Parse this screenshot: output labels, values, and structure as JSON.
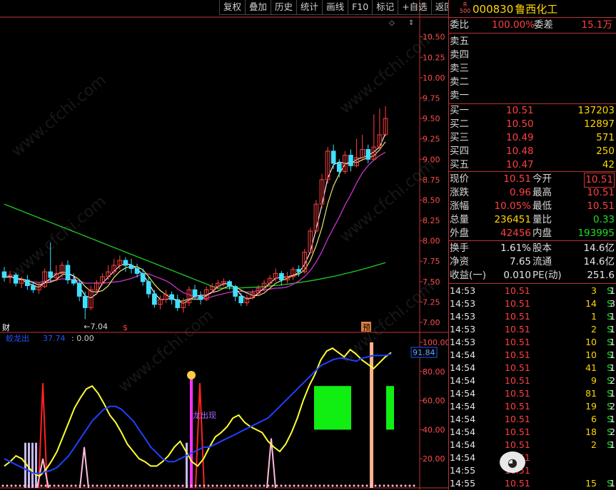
{
  "toolbar": {
    "items": [
      "复权",
      "叠加",
      "历史",
      "统计",
      "画线",
      "F10",
      "标记",
      "+自选",
      "返回"
    ]
  },
  "header": {
    "badge_top": "R",
    "badge_bottom": "500",
    "code": "000830",
    "name": "鲁西化工"
  },
  "quote": {
    "weibi_label": "委比",
    "weibi_value": "100.00%",
    "weicha_label": "委差",
    "weicha_value": "15.1万",
    "sell": [
      {
        "label": "卖五",
        "price": "",
        "volume": ""
      },
      {
        "label": "卖四",
        "price": "",
        "volume": ""
      },
      {
        "label": "卖三",
        "price": "",
        "volume": ""
      },
      {
        "label": "卖二",
        "price": "",
        "volume": ""
      },
      {
        "label": "卖一",
        "price": "",
        "volume": ""
      }
    ],
    "buy": [
      {
        "label": "买一",
        "price": "10.51",
        "volume": "137203"
      },
      {
        "label": "买二",
        "price": "10.50",
        "volume": "12897"
      },
      {
        "label": "买三",
        "price": "10.49",
        "volume": "571"
      },
      {
        "label": "买四",
        "price": "10.48",
        "volume": "250"
      },
      {
        "label": "买五",
        "price": "10.47",
        "volume": "42"
      }
    ],
    "stats": [
      {
        "l1": "现价",
        "v1": "10.51",
        "l2": "今开",
        "v2": "10.51"
      },
      {
        "l1": "涨跌",
        "v1": "0.96",
        "l2": "最高",
        "v2": "10.51"
      },
      {
        "l1": "涨幅",
        "v1": "10.05%",
        "l2": "最低",
        "v2": "10.51"
      },
      {
        "l1": "总量",
        "v1": "236451",
        "l2": "量比",
        "v2": "0.33"
      },
      {
        "l1": "外盘",
        "v1": "42456",
        "l2": "内盘",
        "v2": "193995"
      }
    ],
    "fund": [
      {
        "l1": "换手",
        "v1": "1.61%",
        "l2": "股本",
        "v2": "14.6亿"
      },
      {
        "l1": "净资",
        "v1": "7.65",
        "l2": "流通",
        "v2": "14.6亿"
      },
      {
        "l1": "收益(一)",
        "v1": "0.010",
        "l2": "PE(动)",
        "v2": "251.6"
      }
    ]
  },
  "ticks": [
    {
      "time": "14:53",
      "price": "10.51",
      "vol": "3",
      "side": "S",
      "n": "1"
    },
    {
      "time": "14:53",
      "price": "10.51",
      "vol": "14",
      "side": "S",
      "n": "3"
    },
    {
      "time": "14:53",
      "price": "10.51",
      "vol": "1",
      "side": "S",
      "n": "1"
    },
    {
      "time": "14:53",
      "price": "10.51",
      "vol": "2",
      "side": "S",
      "n": "1"
    },
    {
      "time": "14:53",
      "price": "10.51",
      "vol": "10",
      "side": "S",
      "n": "1"
    },
    {
      "time": "14:54",
      "price": "10.51",
      "vol": "10",
      "side": "S",
      "n": "1"
    },
    {
      "time": "14:54",
      "price": "10.51",
      "vol": "41",
      "side": "S",
      "n": "1"
    },
    {
      "time": "14:54",
      "price": "10.51",
      "vol": "9",
      "side": "S",
      "n": "2"
    },
    {
      "time": "14:54",
      "price": "10.51",
      "vol": "81",
      "side": "S",
      "n": "1"
    },
    {
      "time": "14:54",
      "price": "10.51",
      "vol": "19",
      "side": "S",
      "n": "2"
    },
    {
      "time": "14:54",
      "price": "10.51",
      "vol": "6",
      "side": "S",
      "n": "1"
    },
    {
      "time": "14:54",
      "price": "10.51",
      "vol": "18",
      "side": "S",
      "n": "2"
    },
    {
      "time": "14:54",
      "price": "10.51",
      "vol": "2",
      "side": "S",
      "n": "1"
    },
    {
      "time": "14:54",
      "price": "10.51",
      "vol": "",
      "side": "",
      "n": ""
    },
    {
      "time": "14:55",
      "price": "10.51",
      "vol": "",
      "side": "",
      "n": ""
    },
    {
      "time": "14:55",
      "price": "10.51",
      "vol": "15",
      "side": "S",
      "n": "1"
    }
  ],
  "chart_data": [
    {
      "type": "candlestick",
      "ylim": [
        7.0,
        10.55
      ],
      "yticks": [
        "10.50",
        "10.25",
        "10.00",
        "9.75",
        "9.50",
        "9.25",
        "9.00",
        "8.75",
        "8.50",
        "8.25",
        "8.00",
        "7.75",
        "7.50",
        "7.25",
        "7.00"
      ],
      "low_annotation": "←7.04",
      "markers": [
        "财",
        "$",
        "预"
      ],
      "candles": [
        [
          7.62,
          7.55,
          7.68,
          7.5
        ],
        [
          7.55,
          7.58,
          7.63,
          7.48
        ],
        [
          7.58,
          7.48,
          7.61,
          7.44
        ],
        [
          7.48,
          7.52,
          7.56,
          7.42
        ],
        [
          7.52,
          7.45,
          7.58,
          7.4
        ],
        [
          7.45,
          7.4,
          7.5,
          7.36
        ],
        [
          7.4,
          7.44,
          7.49,
          7.35
        ],
        [
          7.44,
          7.62,
          7.66,
          7.42
        ],
        [
          7.62,
          7.55,
          7.98,
          7.5
        ],
        [
          7.55,
          7.6,
          7.7,
          7.5
        ],
        [
          7.6,
          7.7,
          7.74,
          7.55
        ],
        [
          7.7,
          7.52,
          7.76,
          7.47
        ],
        [
          7.52,
          7.48,
          7.6,
          7.45
        ],
        [
          7.48,
          7.32,
          7.52,
          7.26
        ],
        [
          7.32,
          7.18,
          7.38,
          7.04
        ],
        [
          7.18,
          7.4,
          7.45,
          7.15
        ],
        [
          7.4,
          7.48,
          7.52,
          7.34
        ],
        [
          7.48,
          7.56,
          7.6,
          7.46
        ],
        [
          7.56,
          7.62,
          7.7,
          7.52
        ],
        [
          7.62,
          7.7,
          7.78,
          7.58
        ],
        [
          7.7,
          7.76,
          7.82,
          7.65
        ],
        [
          7.76,
          7.7,
          7.8,
          7.62
        ],
        [
          7.7,
          7.66,
          7.78,
          7.6
        ],
        [
          7.66,
          7.6,
          7.72,
          7.55
        ],
        [
          7.6,
          7.5,
          7.66,
          7.45
        ],
        [
          7.5,
          7.35,
          7.56,
          7.3
        ],
        [
          7.35,
          7.22,
          7.4,
          7.18
        ],
        [
          7.22,
          7.28,
          7.33,
          7.16
        ],
        [
          7.28,
          7.34,
          7.4,
          7.24
        ],
        [
          7.34,
          7.28,
          7.38,
          7.22
        ],
        [
          7.28,
          7.18,
          7.34,
          7.14
        ],
        [
          7.18,
          7.24,
          7.3,
          7.12
        ],
        [
          7.24,
          7.4,
          7.44,
          7.2
        ],
        [
          7.4,
          7.32,
          7.46,
          7.28
        ],
        [
          7.32,
          7.28,
          7.38,
          7.22
        ],
        [
          7.28,
          7.4,
          7.44,
          7.26
        ],
        [
          7.4,
          7.44,
          7.48,
          7.36
        ],
        [
          7.44,
          7.48,
          7.52,
          7.4
        ],
        [
          7.48,
          7.5,
          7.54,
          7.44
        ],
        [
          7.5,
          7.44,
          7.52,
          7.4
        ],
        [
          7.44,
          7.32,
          7.46,
          7.26
        ],
        [
          7.32,
          7.24,
          7.36,
          7.2
        ],
        [
          7.24,
          7.3,
          7.34,
          7.2
        ],
        [
          7.3,
          7.36,
          7.4,
          7.28
        ],
        [
          7.36,
          7.42,
          7.46,
          7.32
        ],
        [
          7.42,
          7.48,
          7.52,
          7.38
        ],
        [
          7.48,
          7.54,
          7.58,
          7.44
        ],
        [
          7.54,
          7.6,
          7.66,
          7.5
        ],
        [
          7.6,
          7.52,
          7.63,
          7.45
        ],
        [
          7.52,
          7.56,
          7.62,
          7.48
        ],
        [
          7.56,
          7.65,
          7.68,
          7.52
        ],
        [
          7.65,
          7.62,
          7.7,
          7.56
        ],
        [
          7.62,
          7.86,
          7.9,
          7.6
        ],
        [
          7.86,
          8.12,
          8.16,
          7.84
        ],
        [
          8.12,
          8.45,
          8.5,
          8.1
        ],
        [
          8.45,
          8.75,
          8.82,
          8.4
        ],
        [
          8.75,
          9.1,
          9.15,
          8.7
        ],
        [
          9.1,
          8.95,
          9.18,
          8.88
        ],
        [
          8.95,
          8.85,
          9.0,
          8.78
        ],
        [
          8.85,
          9.05,
          9.1,
          8.82
        ],
        [
          9.05,
          8.92,
          9.12,
          8.85
        ],
        [
          8.92,
          9.02,
          9.25,
          8.9
        ],
        [
          9.02,
          9.12,
          9.3,
          9.0
        ],
        [
          9.12,
          9.0,
          9.18,
          8.95
        ],
        [
          9.0,
          9.15,
          9.55,
          8.98
        ],
        [
          9.15,
          9.3,
          9.62,
          9.1
        ],
        [
          9.3,
          9.5,
          9.65,
          9.28
        ]
      ]
    },
    {
      "type": "line",
      "title": "蛟龙出",
      "value": "37.74",
      "extra": ": 0.00",
      "ylim": [
        0,
        100
      ],
      "yticks": [
        "100.00",
        "80.00",
        "60.00",
        "40.00",
        "20.00"
      ],
      "current_label": "91.84",
      "annotation": "龙出现",
      "series": [
        {
          "name": "yellow",
          "color": "#ffff33",
          "values": [
            15,
            18,
            22,
            20,
            15,
            10,
            8,
            12,
            18,
            25,
            35,
            45,
            55,
            62,
            68,
            70,
            65,
            58,
            50,
            45,
            38,
            30,
            25,
            20,
            18,
            15,
            15,
            18,
            22,
            28,
            32,
            25,
            18,
            15,
            20,
            28,
            35,
            38,
            42,
            48,
            50,
            45,
            42,
            40,
            38,
            32,
            28,
            25,
            30,
            38,
            48,
            60,
            70,
            78,
            88,
            94,
            96,
            93,
            90,
            95,
            92,
            88,
            85,
            82,
            86,
            90,
            93
          ]
        },
        {
          "name": "blue",
          "color": "#2040ff",
          "values": [
            20,
            18,
            16,
            14,
            12,
            10,
            10,
            11,
            12,
            14,
            18,
            22,
            28,
            34,
            40,
            46,
            50,
            54,
            56,
            56,
            54,
            50,
            46,
            40,
            34,
            28,
            24,
            20,
            18,
            18,
            20,
            22,
            24,
            26,
            28,
            28,
            30,
            32,
            34,
            36,
            38,
            40,
            42,
            44,
            46,
            48,
            52,
            56,
            60,
            64,
            68,
            72,
            76,
            80,
            84,
            86,
            88,
            89,
            89,
            88,
            87,
            89,
            90,
            91,
            91,
            91,
            92
          ]
        }
      ]
    }
  ]
}
